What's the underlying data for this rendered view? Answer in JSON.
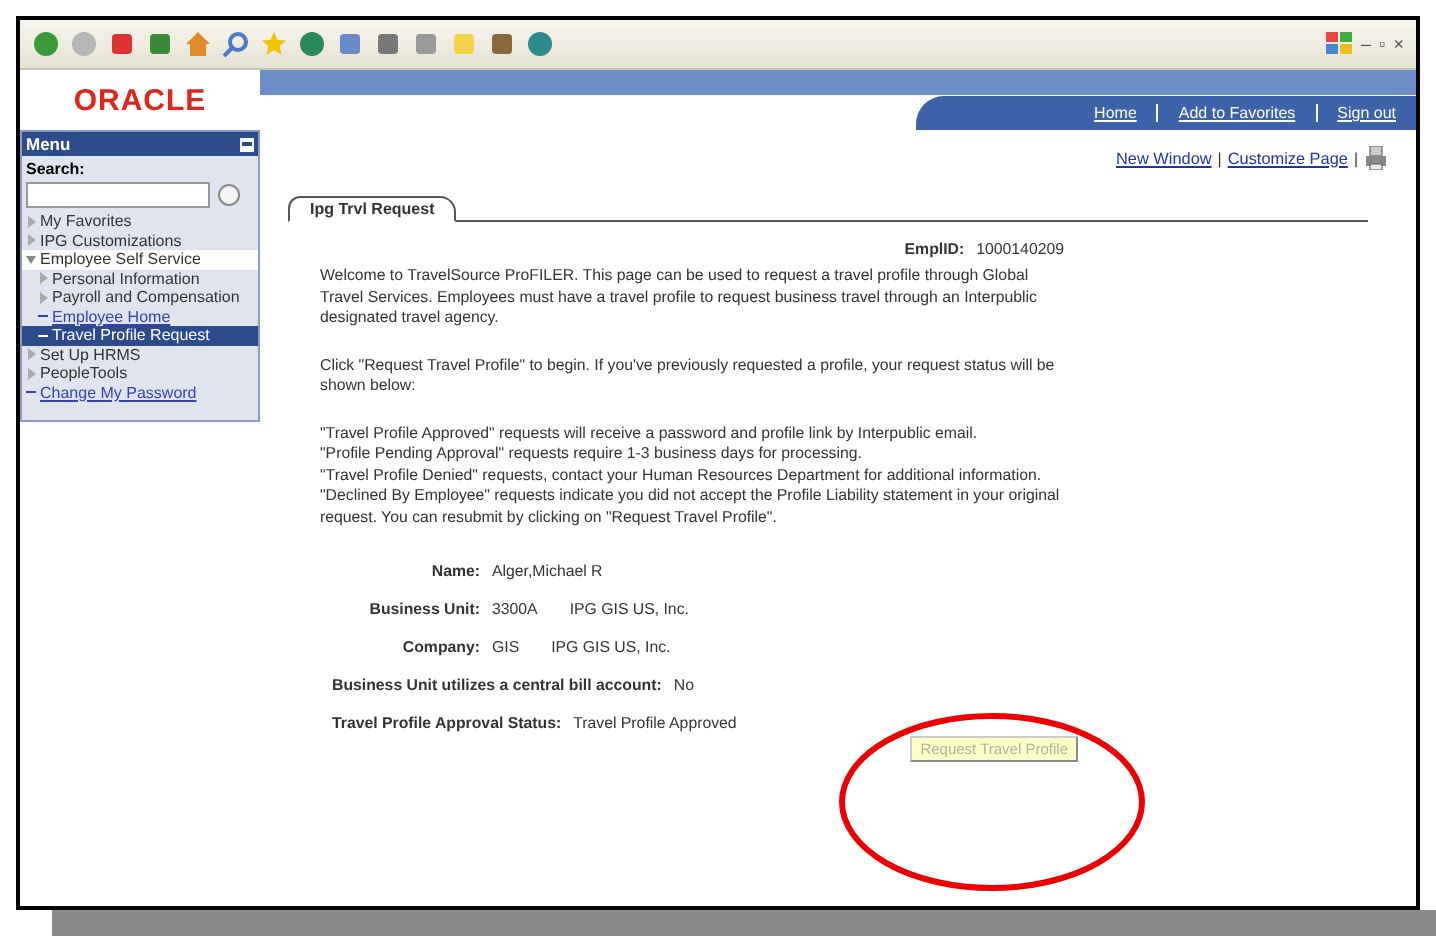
{
  "browser": {
    "window_controls": [
      "–",
      "▫",
      "×"
    ]
  },
  "header": {
    "logo": "ORACLE",
    "links": [
      "Home",
      "Add to Favorites",
      "Sign out"
    ]
  },
  "menu": {
    "title": "Menu",
    "search_label": "Search:",
    "items": [
      {
        "label": "My Favorites",
        "kind": "folder",
        "expanded": false,
        "selected": false
      },
      {
        "label": "IPG Customizations",
        "kind": "folder",
        "expanded": false,
        "selected": false
      },
      {
        "label": "Employee Self Service",
        "kind": "folder",
        "expanded": true,
        "selected": false,
        "children": [
          {
            "label": "Personal Information",
            "kind": "folder",
            "expanded": false,
            "selected": false
          },
          {
            "label": "Payroll and Compensation",
            "kind": "folder",
            "expanded": false,
            "selected": false
          },
          {
            "label": "Employee Home",
            "kind": "link",
            "selected": false
          },
          {
            "label": "Travel Profile Request",
            "kind": "link",
            "selected": true
          }
        ]
      },
      {
        "label": "Set Up HRMS",
        "kind": "folder",
        "expanded": false,
        "selected": false
      },
      {
        "label": "PeopleTools",
        "kind": "folder",
        "expanded": false,
        "selected": false
      },
      {
        "label": "Change My Password",
        "kind": "link",
        "selected": false
      }
    ]
  },
  "page_links": [
    {
      "label": "New Window",
      "separator": "|"
    },
    {
      "label": "Customize Page",
      "separator": "|"
    }
  ],
  "tab": {
    "label": "Ipg Trvl Request",
    "selected": true
  },
  "empl_id": {
    "label": "EmplID:",
    "value": "1000140209"
  },
  "paragraphs": [
    [
      "Welcome to TravelSource ProFILER. This page can be used to request a travel profile through Global Travel Services. Employees must have a travel profile to request business travel through an Interpublic designated travel agency."
    ],
    [
      "Click \"Request Travel Profile\" to begin. If you've previously requested a profile, your request status will be shown below:"
    ],
    [
      "\"Travel Profile Approved\" requests will receive a password and profile link by Interpublic email.",
      "\"Profile Pending Approval\" requests require 1-3 business days for processing.",
      "\"Travel Profile Denied\" requests, contact your Human Resources Department for additional information.",
      "\"Declined By Employee\" requests indicate you did not accept the Profile Liability statement in your original request. You can resubmit by clicking on \"Request Travel Profile\"."
    ]
  ],
  "fields": [
    {
      "label": "Name:",
      "kind": "aligned",
      "values": [
        "Alger,Michael R"
      ]
    },
    {
      "label": "Business Unit:",
      "kind": "aligned",
      "values": [
        "3300A",
        "IPG GIS US, Inc."
      ]
    },
    {
      "label": "Company:",
      "kind": "aligned",
      "values": [
        "GIS",
        "IPG GIS US, Inc."
      ]
    },
    {
      "label": "Business Unit utilizes a central bill account:",
      "kind": "free",
      "values": [
        "No"
      ]
    },
    {
      "label": "Travel Profile Approval Status:",
      "kind": "free",
      "values": [
        "Travel Profile Approved"
      ]
    }
  ],
  "request_button": {
    "label": "Request Travel Profile",
    "disabled": true
  },
  "annotation": {
    "kind": "ellipse"
  }
}
